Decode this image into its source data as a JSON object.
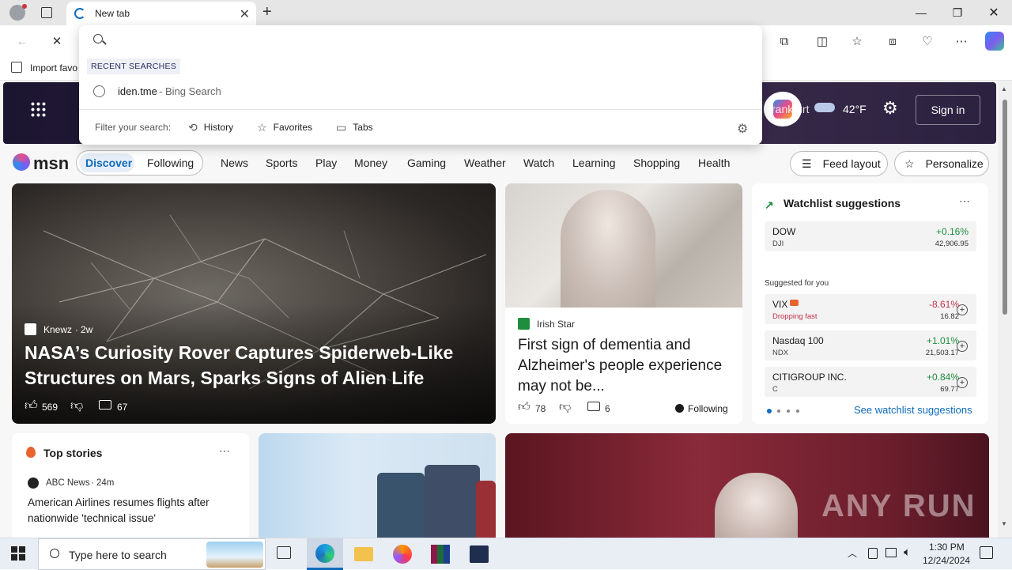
{
  "browser": {
    "tab_title": "New tab",
    "import_favorites": "Import favo",
    "colors": {
      "accent": "#0f6cbd",
      "titlebar": "#e6e6e6"
    }
  },
  "dropdown": {
    "recent_label": "RECENT SEARCHES",
    "recent_item_query": "iden.tme",
    "recent_item_source": " - Bing Search",
    "filter_label": "Filter your search:",
    "filters": [
      "History",
      "Favorites",
      "Tabs"
    ]
  },
  "msn": {
    "logo": "msn",
    "location": "rankfurt",
    "temperature": "42°F",
    "sign_in": "Sign in",
    "tabs": [
      "Discover",
      "Following"
    ],
    "nav": [
      "News",
      "Sports",
      "Play",
      "Money",
      "Gaming",
      "Weather",
      "Watch",
      "Learning",
      "Shopping",
      "Health"
    ],
    "feed_layout": "Feed layout",
    "personalize": "Personalize"
  },
  "hero": {
    "source": "Knewz",
    "age": "2w",
    "title": "NASA’s Curiosity Rover Captures Spiderweb-Like Structures on Mars, Sparks Signs of Alien Life",
    "likes": "569",
    "comments": "67"
  },
  "article2": {
    "source": "Irish Star",
    "title": "First sign of dementia and Alzheimer's people experience may not be...",
    "likes": "78",
    "comments": "6",
    "following": "Following"
  },
  "watchlist": {
    "title": "Watchlist suggestions",
    "suggested_label": "Suggested for you",
    "see_more": "See watchlist suggestions",
    "items": [
      {
        "name": "DOW",
        "ticker": "DJI",
        "change": "+0.16%",
        "price": "42,906.95",
        "dir": "up"
      },
      {
        "name": "VIX",
        "ticker": "Dropping fast",
        "change": "-8.61%",
        "price": "16.82",
        "dir": "down"
      },
      {
        "name": "Nasdaq 100",
        "ticker": "NDX",
        "change": "+1.01%",
        "price": "21,503.17",
        "dir": "up"
      },
      {
        "name": "CITIGROUP INC.",
        "ticker": "C",
        "change": "+0.84%",
        "price": "69.77",
        "dir": "up"
      }
    ]
  },
  "top_stories": {
    "title": "Top stories",
    "source": "ABC News",
    "age": "24m",
    "headline": "American Airlines resumes flights after nationwide 'technical issue'"
  },
  "watermark": "ANY RUN",
  "taskbar": {
    "search_placeholder": "Type here to search",
    "time": "1:30 PM",
    "date": "12/24/2024"
  }
}
